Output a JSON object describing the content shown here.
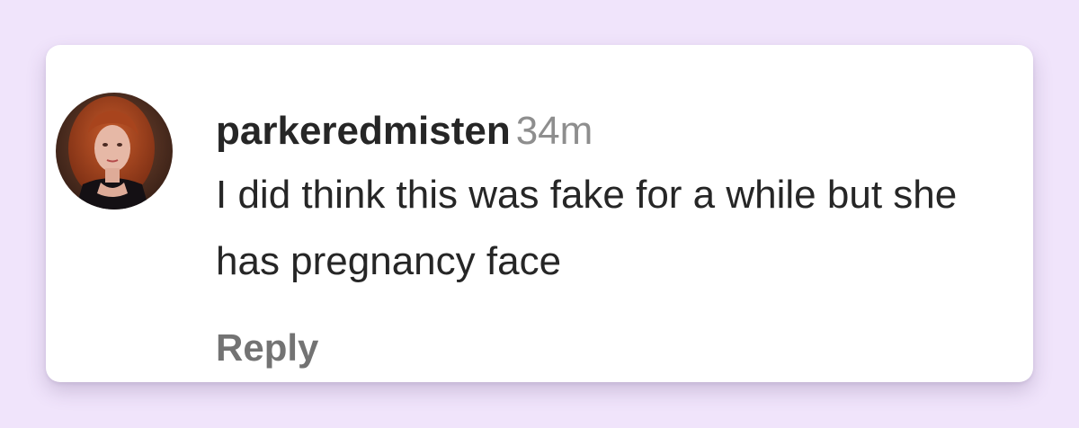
{
  "comment": {
    "username": "parkeredmisten",
    "timestamp": "34m",
    "text": "I did think this was fake for a while but she has pregnancy face",
    "reply_label": "Reply"
  },
  "colors": {
    "background": "#f0e4fb",
    "card": "#ffffff",
    "text": "#262626",
    "muted": "#8e8e8e",
    "reply": "#737373"
  }
}
